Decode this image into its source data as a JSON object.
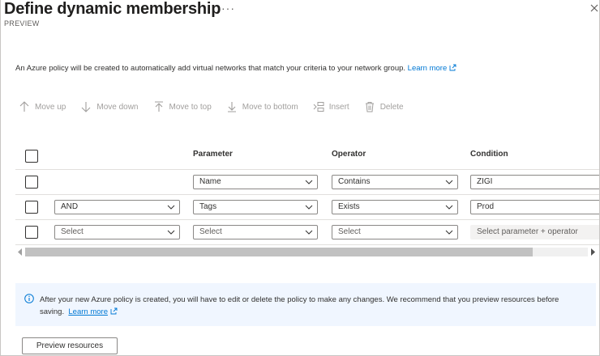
{
  "blade": {
    "title": "Define dynamic membership",
    "more_label": "···",
    "subtitle": "PREVIEW"
  },
  "intro": {
    "text": "An Azure policy will be created to automatically add virtual networks that match your criteria to your network group.",
    "link": "Learn more"
  },
  "toolbar": {
    "move_up": "Move up",
    "move_down": "Move down",
    "move_to_top": "Move to top",
    "move_to_bottom": "Move to bottom",
    "insert": "Insert",
    "delete": "Delete"
  },
  "grid": {
    "columns": [
      "",
      "",
      "Parameter",
      "Operator",
      "Condition"
    ],
    "rows": [
      {
        "logic": "",
        "parameter": "Name",
        "operator": "Contains",
        "condition": "ZIGI"
      },
      {
        "logic": "AND",
        "parameter": "Tags",
        "operator": "Exists",
        "condition": "Prod"
      },
      {
        "logic": "Select",
        "parameter": "Select",
        "operator": "Select",
        "condition": "Select parameter + operator"
      }
    ]
  },
  "info": {
    "text": "After your new Azure policy is created, you will have to edit or delete the policy to make any changes. We recommend that you preview resources before saving.",
    "link": "Learn more"
  },
  "footer": {
    "preview_label": "Preview resources"
  },
  "colors": {
    "accent": "#0078d4",
    "info_bg": "#f0f6ff",
    "disabled_text": "#a19f9d"
  }
}
